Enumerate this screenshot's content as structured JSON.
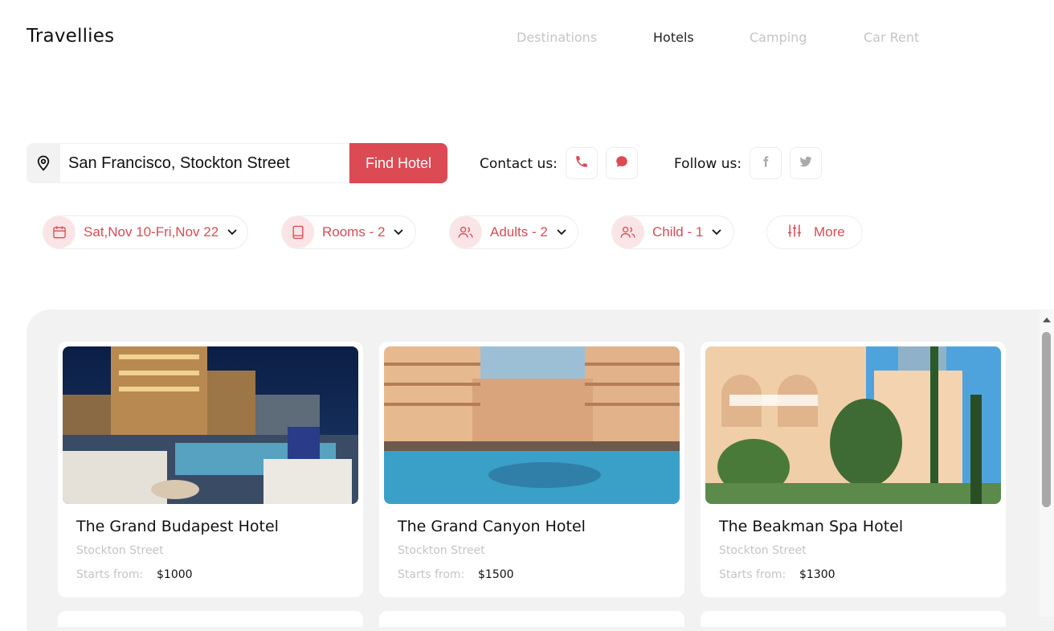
{
  "app": {
    "logo": "Travellies"
  },
  "nav": {
    "items": [
      "Destinations",
      "Hotels",
      "Camping",
      "Car Rent"
    ],
    "active": "Hotels"
  },
  "search": {
    "value": "San Francisco, Stockton Street",
    "button_label": "Find Hotel"
  },
  "contact": {
    "label": "Contact us:",
    "icons": [
      "phone-icon",
      "chat-icon"
    ]
  },
  "follow": {
    "label": "Follow us:",
    "icons": [
      "facebook-icon",
      "twitter-icon"
    ]
  },
  "filters": {
    "dates": "Sat,Nov 10-Fri,Nov 22",
    "rooms": "Rooms - 2",
    "adults": "Adults - 2",
    "child": "Child - 1",
    "more": "More"
  },
  "hotels": [
    {
      "name": "The Grand Budapest Hotel",
      "street": "Stockton Street",
      "from_label": "Starts from:",
      "price": "$1000"
    },
    {
      "name": "The Grand Canyon Hotel",
      "street": "Stockton Street",
      "from_label": "Starts from:",
      "price": "$1500"
    },
    {
      "name": "The Beakman Spa Hotel",
      "street": "Stockton Street",
      "from_label": "Starts from:",
      "price": "$1300"
    }
  ],
  "colors": {
    "accent": "#dc4a54",
    "accent_soft": "#fbe4e6",
    "muted": "#c5c5c5",
    "panel": "#f2f2f3"
  }
}
